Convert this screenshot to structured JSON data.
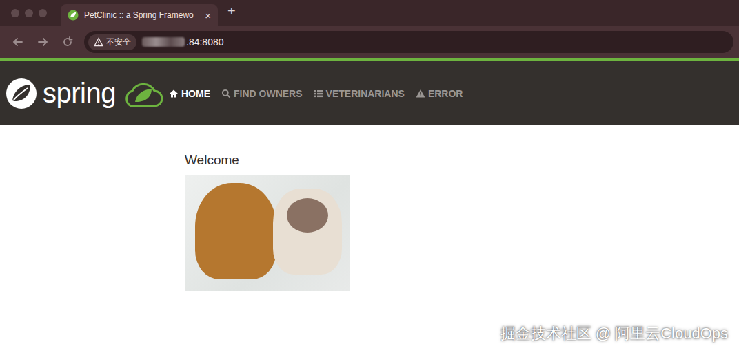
{
  "browser": {
    "tabs": [
      {
        "title": "PetClinic :: a Spring Framewo",
        "close": "×",
        "selected": true
      }
    ],
    "new_tab": "+",
    "security": "不安全",
    "url": ".84:8080"
  },
  "navbar": {
    "logo": "spring",
    "items": [
      {
        "label": "HOME",
        "selected": true
      },
      {
        "label": "FIND OWNERS",
        "selected": false
      },
      {
        "label": "VETERINARIANS",
        "selected": false
      },
      {
        "label": "ERROR",
        "selected": false
      }
    ]
  },
  "content": {
    "heading": "Welcome"
  },
  "watermark": "掘金技术社区 @ 阿里云CloudOps"
}
